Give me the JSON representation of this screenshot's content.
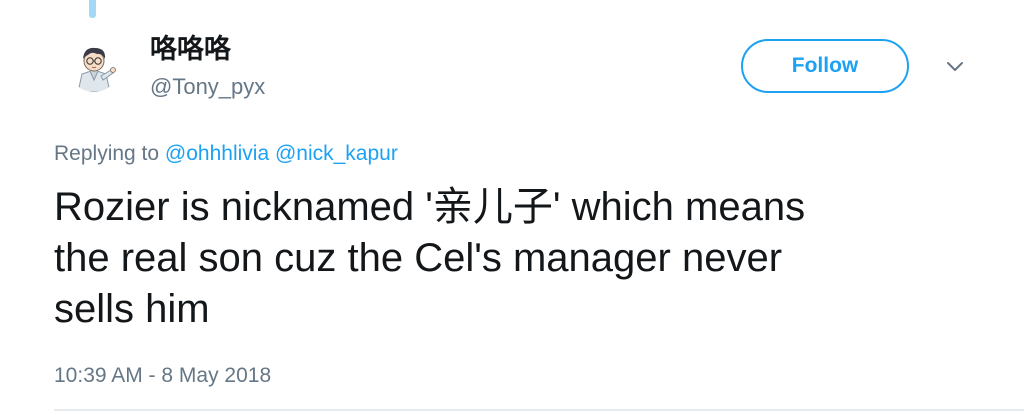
{
  "author": {
    "display_name": "咯咯咯",
    "handle": "@Tony_pyx",
    "avatar_icon": "anime-character-avatar"
  },
  "actions": {
    "follow_label": "Follow",
    "more_icon": "chevron-down-icon"
  },
  "reply": {
    "prefix": "Replying to",
    "mentions": [
      "@ohhhlivia",
      "@nick_kapur"
    ]
  },
  "tweet": {
    "lines": [
      "Rozier is nicknamed '亲儿子' which means",
      "the real son cuz the Cel's manager never",
      "sells him"
    ]
  },
  "meta": {
    "timestamp": "10:39 AM - 8 May 2018"
  },
  "colors": {
    "accent": "#1da1f2",
    "text": "#14171a",
    "secondary_text": "#657786",
    "divider": "#e6ecf0",
    "thread_line": "#a4d9f5"
  }
}
